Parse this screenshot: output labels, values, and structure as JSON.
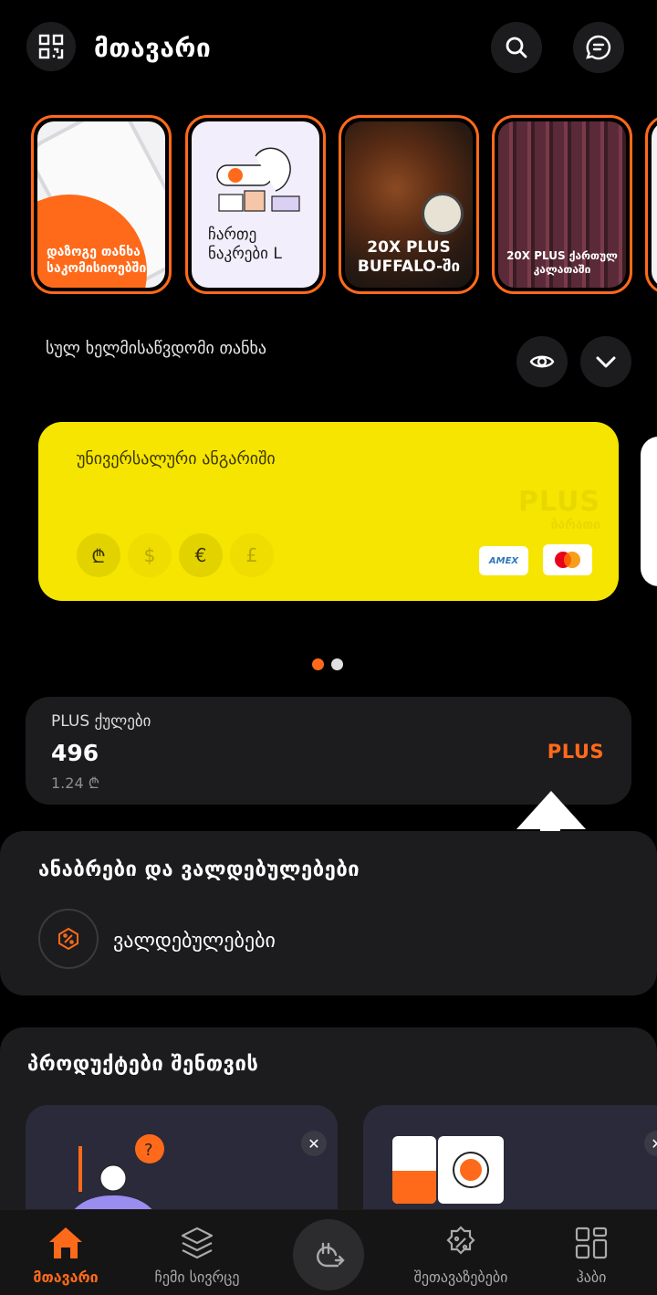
{
  "header": {
    "title": "მთავარი"
  },
  "stories": [
    {
      "caption": "დაზოგე თანხა საკომისიოებში"
    },
    {
      "caption": "ჩართე ნაკრები L"
    },
    {
      "caption": "20X PLUS BUFFALO-ში"
    },
    {
      "caption": "20X PLUS ქართულ კალათაში"
    }
  ],
  "balance": {
    "label": "სულ ხელმისაწვდომი თანხა"
  },
  "card": {
    "title": "უნივერსალური ანგარიში",
    "currencies": [
      "₾",
      "$",
      "€",
      "£"
    ],
    "watermark_top": "PLUS",
    "watermark_bottom": "ბარათი",
    "amex": "AMEX"
  },
  "plus": {
    "label": "PLUS ქულები",
    "value": "496",
    "sub": "1.24 ₾",
    "brand": "PLUS"
  },
  "deposits": {
    "title": "ანაბრები და ვალდებულებები",
    "item": "ვალდებულებები"
  },
  "products": {
    "title": "პროდუქტები შენთვის"
  },
  "nav": {
    "items": [
      {
        "label": "მთავარი"
      },
      {
        "label": "ჩემი სივრცე"
      },
      {
        "label": "შეთავაზებები"
      },
      {
        "label": "ჰაბი"
      }
    ]
  },
  "colors": {
    "accent": "#ff6a1a",
    "card": "#f6e500"
  }
}
